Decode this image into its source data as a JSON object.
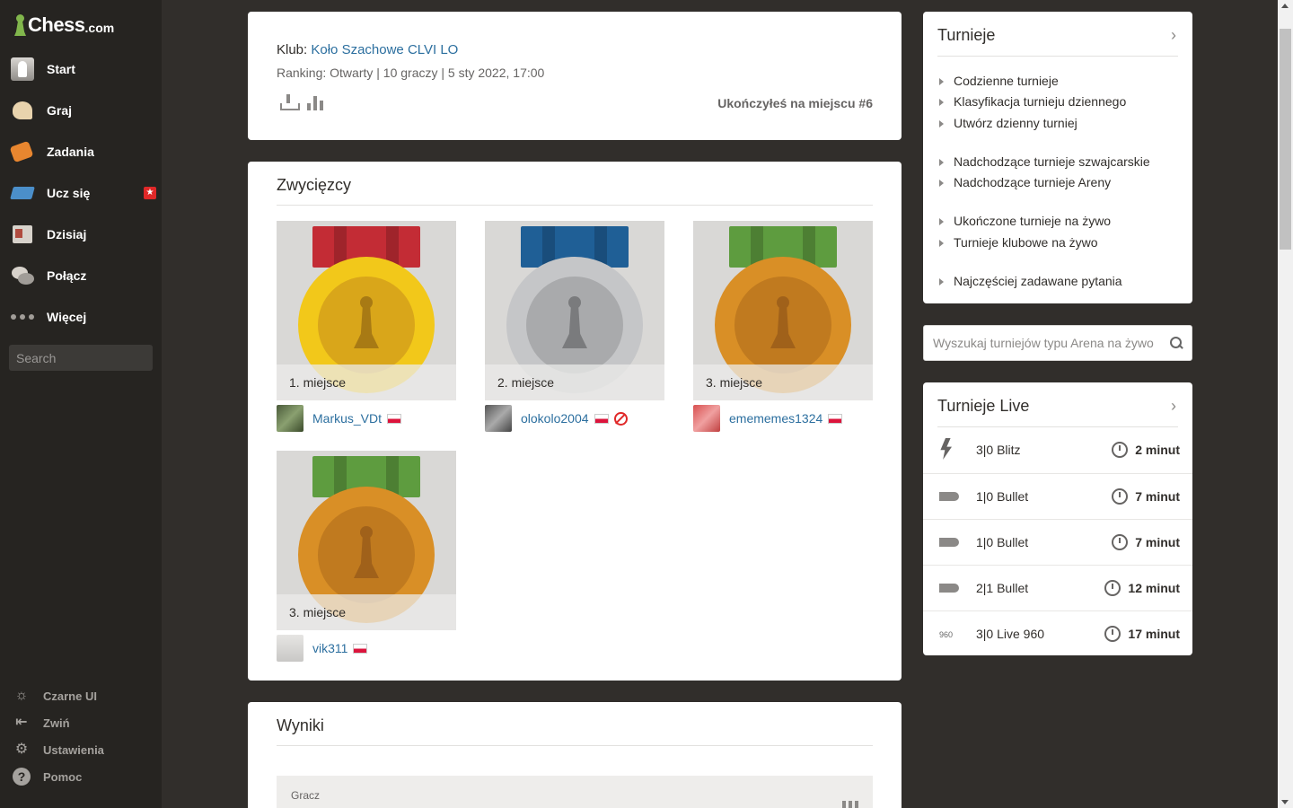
{
  "logo": {
    "word": "Chess",
    "domain": ".com"
  },
  "sidebar": {
    "items": [
      {
        "label": "Start",
        "icon": "home-avatar-icon"
      },
      {
        "label": "Graj",
        "icon": "play-icon"
      },
      {
        "label": "Zadania",
        "icon": "puzzle-icon"
      },
      {
        "label": "Ucz się",
        "icon": "learn-icon",
        "badge": "★"
      },
      {
        "label": "Dzisiaj",
        "icon": "news-icon"
      },
      {
        "label": "Połącz",
        "icon": "social-icon"
      },
      {
        "label": "Więcej",
        "icon": "more-dots-icon"
      }
    ],
    "search_placeholder": "Search",
    "bottom": [
      {
        "label": "Czarne UI",
        "icon": "theme-icon"
      },
      {
        "label": "Zwiń",
        "icon": "collapse-icon"
      },
      {
        "label": "Ustawienia",
        "icon": "gear-icon"
      },
      {
        "label": "Pomoc",
        "icon": "help-icon",
        "glyph": "?"
      }
    ]
  },
  "club": {
    "label": "Klub:",
    "name": "Koło Szachowe CLVI LO",
    "ranking": "Ranking: Otwarty | 10 graczy | 5 sty 2022, 17:00",
    "finish": "Ukończyłeś na miejscu #6"
  },
  "winners": {
    "title": "Zwycięzcy",
    "entries": [
      {
        "place": "1. miejsce",
        "player": "Markus_VDt",
        "medal": "gold",
        "ribbon": "#c32c35"
      },
      {
        "place": "2. miejsce",
        "player": "olokolo2004",
        "medal": "silver",
        "ribbon": "#1f5f96",
        "banned": true
      },
      {
        "place": "3. miejsce",
        "player": "emememes1324",
        "medal": "bronze",
        "ribbon": "#5e9c3f"
      },
      {
        "place": "3. miejsce",
        "player": "vik311",
        "medal": "bronze",
        "ribbon": "#5e9c3f"
      }
    ]
  },
  "results": {
    "title": "Wyniki",
    "col_player": "Gracz"
  },
  "tournaments": {
    "title": "Turnieje",
    "arrow": "›",
    "links": [
      "Codzienne turnieje",
      "Klasyfikacja turnieju dziennego",
      "Utwórz dzienny turniej",
      "Nadchodzące turnieje szwajcarskie",
      "Nadchodzące turnieje Areny",
      "Ukończone turnieje na żywo",
      "Turnieje klubowe na żywo",
      "Najczęściej zadawane pytania"
    ]
  },
  "arena_search": {
    "placeholder": "Wyszukaj turniejów typu Arena na żywo"
  },
  "live": {
    "title": "Turnieje Live",
    "arrow": "›",
    "rows": [
      {
        "name": "3|0 Blitz",
        "time": "2 minut",
        "icon": "blitz-icon"
      },
      {
        "name": "1|0 Bullet",
        "time": "7 minut",
        "icon": "bullet-icon"
      },
      {
        "name": "1|0 Bullet",
        "time": "7 minut",
        "icon": "bullet-icon"
      },
      {
        "name": "2|1 Bullet",
        "time": "12 minut",
        "icon": "bullet-icon"
      },
      {
        "name": "3|0 Live 960",
        "time": "17 minut",
        "icon": "chess960-icon",
        "icon_text": "960"
      }
    ]
  }
}
